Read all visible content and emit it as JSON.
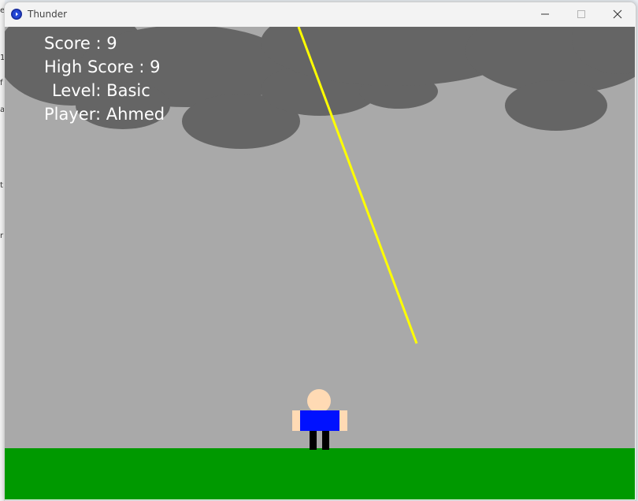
{
  "window": {
    "title": "Thunder"
  },
  "hud": {
    "score_text": "Score : 9",
    "high_score_text": "High Score : 9",
    "level_text": "Level: Basic",
    "player_text": "Player: Ahmed"
  },
  "game": {
    "score": 9,
    "high_score": 9,
    "level": "Basic",
    "player": "Ahmed"
  },
  "colors": {
    "sky": "#a9a9a9",
    "cloud": "#656565",
    "ground": "#009900",
    "lightning": "#ffff00",
    "shirt": "#0011ff",
    "skin": "#ffdab4",
    "legs": "#000000"
  },
  "icons": {
    "app": "app-icon",
    "minimize": "minimize-icon",
    "maximize": "maximize-icon",
    "close": "close-icon"
  }
}
